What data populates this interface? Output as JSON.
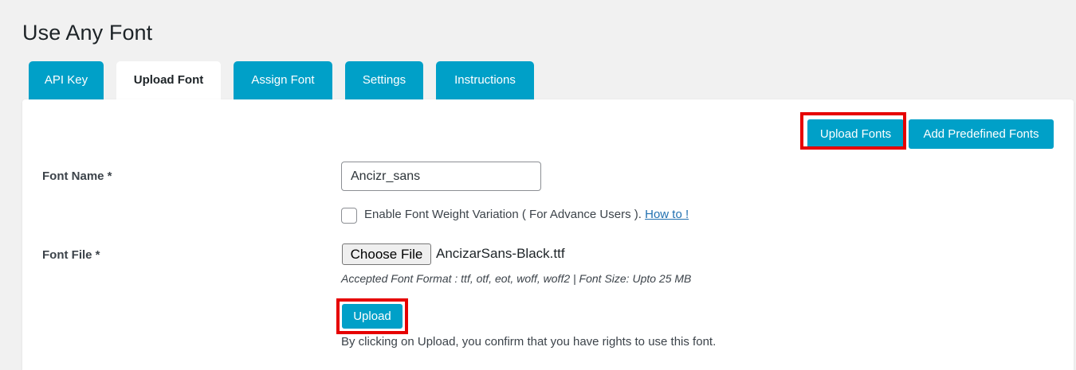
{
  "page": {
    "title": "Use Any Font"
  },
  "tabs": [
    {
      "label": "API Key",
      "active": false
    },
    {
      "label": "Upload Font",
      "active": true
    },
    {
      "label": "Assign Font",
      "active": false
    },
    {
      "label": "Settings",
      "active": false
    },
    {
      "label": "Instructions",
      "active": false
    }
  ],
  "actions": {
    "upload_fonts_label": "Upload Fonts",
    "add_predefined_label": "Add Predefined Fonts"
  },
  "form": {
    "font_name_label": "Font Name *",
    "font_name_value": "Ancizr_sans",
    "weight_variation_text": "Enable Font Weight Variation ( For Advance Users ).",
    "weight_variation_checked": false,
    "how_to_link": "How to !",
    "font_file_label": "Font File *",
    "choose_file_label": "Choose File",
    "chosen_file_name": "AncizarSans-Black.ttf",
    "format_hint": "Accepted Font Format : ttf, otf, eot, woff, woff2 | Font Size: Upto 25 MB",
    "upload_label": "Upload",
    "consent_text": "By clicking on Upload, you confirm that you have rights to use this font."
  },
  "colors": {
    "accent": "#00a0c8",
    "highlight": "#e60000",
    "background": "#f1f1f1",
    "link": "#2271b1"
  }
}
